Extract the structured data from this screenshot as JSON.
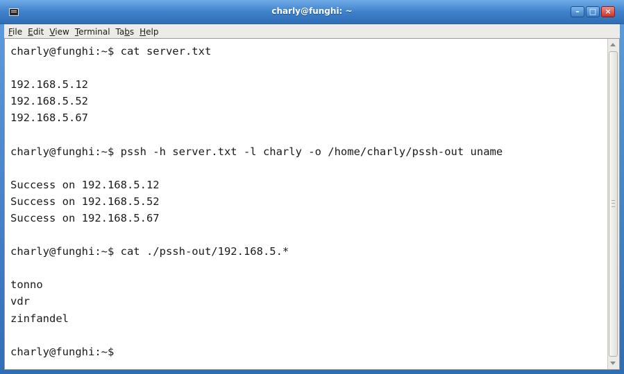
{
  "window": {
    "title": "charly@funghi: ~"
  },
  "menubar": {
    "items": [
      {
        "label": "File",
        "mnemonic": "F",
        "rest": "ile"
      },
      {
        "label": "Edit",
        "mnemonic": "E",
        "rest": "dit"
      },
      {
        "label": "View",
        "mnemonic": "V",
        "rest": "iew"
      },
      {
        "label": "Terminal",
        "mnemonic": "T",
        "rest": "erminal"
      },
      {
        "label": "Tabs",
        "pre": "Ta",
        "mnemonic": "b",
        "rest": "s"
      },
      {
        "label": "Help",
        "mnemonic": "H",
        "rest": "elp"
      }
    ]
  },
  "terminal": {
    "lines": [
      "charly@funghi:~$ cat server.txt",
      "",
      "192.168.5.12",
      "192.168.5.52",
      "192.168.5.67",
      "",
      "charly@funghi:~$ pssh -h server.txt -l charly -o /home/charly/pssh-out uname",
      "",
      "Success on 192.168.5.12",
      "Success on 192.168.5.52",
      "Success on 192.168.5.67",
      "",
      "charly@funghi:~$ cat ./pssh-out/192.168.5.*",
      "",
      "tonno",
      "vdr",
      "zinfandel",
      "",
      "charly@funghi:~$"
    ]
  },
  "icons": {
    "app": "terminal-icon",
    "minimize": "minimize-icon",
    "maximize": "maximize-icon",
    "close": "close-icon"
  },
  "colors": {
    "titlebar": "#3f82cb",
    "terminal_bg": "#ffffff",
    "terminal_fg": "#1a1a1a",
    "close_button": "#c9322a"
  }
}
